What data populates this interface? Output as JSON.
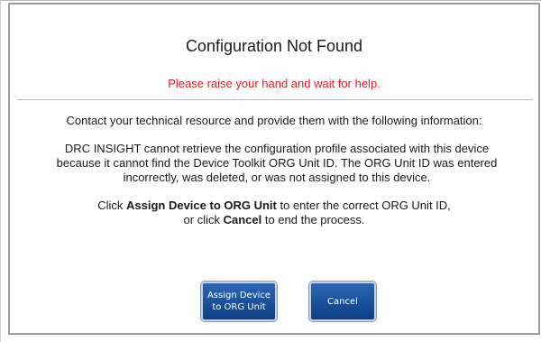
{
  "dialog": {
    "title": "Configuration Not Found",
    "alert": "Please raise your hand and wait for help.",
    "instructions": "Contact your technical resource and provide them with the following information:",
    "details": "DRC INSIGHT cannot retrieve the configuration profile associated with this device because it cannot find the Device Toolkit ORG Unit ID. The ORG Unit ID was entered incorrectly, was deleted, or was not assigned to this device.",
    "action_help": {
      "line1_prefix": "Click ",
      "line1_bold": "Assign Device to ORG Unit",
      "line1_suffix": " to enter the correct ORG Unit ID,",
      "line2_prefix": "or click ",
      "line2_bold": "Cancel",
      "line2_suffix": " to end the process."
    },
    "buttons": {
      "assign_label": "Assign Device\nto ORG Unit",
      "cancel_label": "Cancel"
    }
  },
  "colors": {
    "alert_text": "#e8191e",
    "button_top": "#2c67b1",
    "button_bottom": "#0b3f86",
    "dialog_border": "#9a9a9a"
  }
}
